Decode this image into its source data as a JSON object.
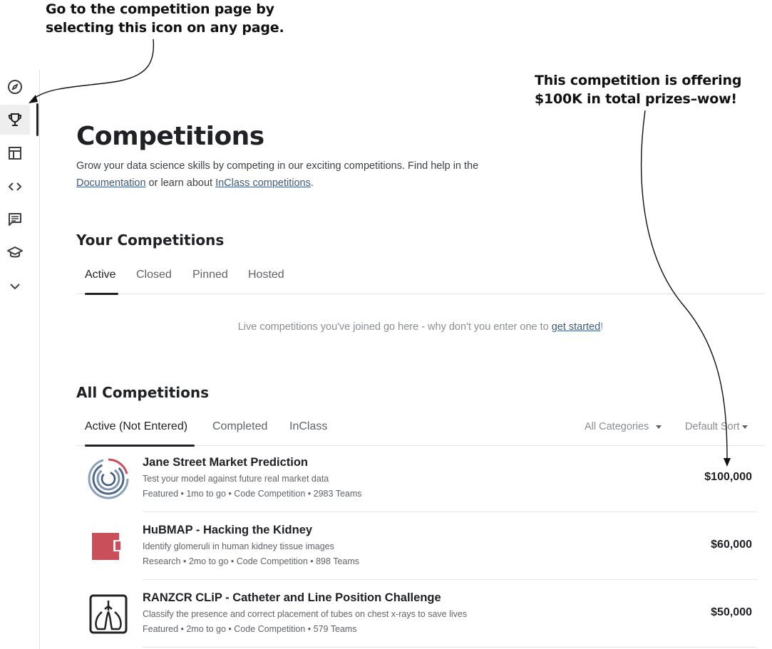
{
  "annotations": {
    "top_line1": "Go to the competition page by",
    "top_line2": "selecting this icon on any page.",
    "right_line1": "This competition is offering",
    "right_line2": "$100K in total prizes–wow!"
  },
  "sidebar": {
    "items": [
      {
        "icon": "compass-icon"
      },
      {
        "icon": "trophy-icon",
        "active": true
      },
      {
        "icon": "table-icon"
      },
      {
        "icon": "code-icon"
      },
      {
        "icon": "comment-icon"
      },
      {
        "icon": "graduation-cap-icon"
      },
      {
        "icon": "chevron-down-icon"
      }
    ]
  },
  "header": {
    "title": "Competitions",
    "description_prefix": "Grow your data science skills by competing in our exciting competitions. Find help in the",
    "documentation_link": "Documentation",
    "description_middle": " or learn about ",
    "inclass_link": "InClass competitions",
    "description_suffix": "."
  },
  "your_competitions": {
    "title": "Your Competitions",
    "tabs": [
      "Active",
      "Closed",
      "Pinned",
      "Hosted"
    ],
    "active_tab": "Active",
    "empty_message_prefix": "Live competitions you've joined go here - why don't you enter one to ",
    "empty_message_link": "get started",
    "empty_message_suffix": "!"
  },
  "all_competitions": {
    "title": "All Competitions",
    "tabs": [
      "Active (Not Entered)",
      "Completed",
      "InClass"
    ],
    "active_tab": "Active (Not Entered)",
    "category_filter": "All Categories",
    "sort_filter": "Default Sort",
    "items": [
      {
        "title": "Jane Street Market Prediction",
        "subtitle": "Test your model against future real market data",
        "meta": "Featured • 1mo to go • Code Competition • 2983 Teams",
        "prize": "$100,000",
        "thumb_icon": "jane-street-logo"
      },
      {
        "title": "HuBMAP - Hacking the Kidney",
        "subtitle": "Identify glomeruli in human kidney tissue images",
        "meta": "Research • 2mo to go • Code Competition • 898 Teams",
        "prize": "$60,000",
        "thumb_icon": "hubmap-logo"
      },
      {
        "title": "RANZCR CLiP - Catheter and Line Position Challenge",
        "subtitle": "Classify the presence and correct placement of tubes on chest x-rays to save lives",
        "meta": "Featured • 2mo to go • Code Competition • 579 Teams",
        "prize": "$50,000",
        "thumb_icon": "chest-xray-logo"
      }
    ]
  },
  "colors": {
    "text": "#202124",
    "muted": "#5f6368",
    "link": "#3c5a80",
    "hubmap_red": "#c9505a"
  }
}
